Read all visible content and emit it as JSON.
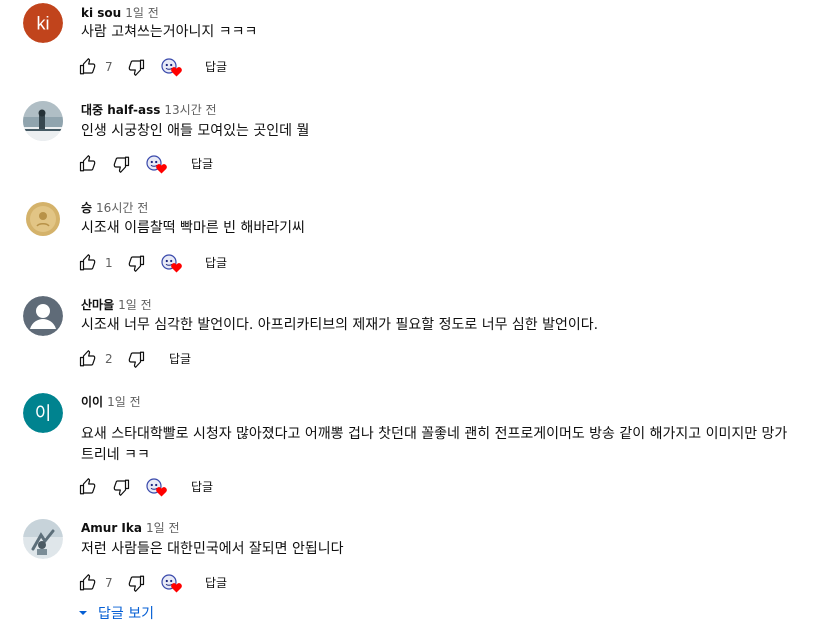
{
  "comments": [
    {
      "author": "ki sou",
      "time": "1일 전",
      "text": "사람 고쳐쓰는거아니지 ㅋㅋㅋ",
      "likes": "7",
      "reply_label": "답글",
      "avatar_text": "ki",
      "avatar_color": "#c1441c"
    },
    {
      "author": "대중 half-ass",
      "time": "13시간 전",
      "text": "인생 시궁창인 애들 모여있는 곳인데 뭘",
      "likes": "",
      "reply_label": "답글"
    },
    {
      "author": "승",
      "time": "16시간 전",
      "text": "시조새 이름찰떡 빡마른 빈 해바라기씨",
      "likes": "1",
      "reply_label": "답글"
    },
    {
      "author": "산마을",
      "time": "1일 전",
      "text": "시조새 너무 심각한 발언이다. 아프리카티브의 제재가 필요할 정도로 너무 심한 발언이다.",
      "likes": "2",
      "reply_label": "답글"
    },
    {
      "author": "이이",
      "time": "1일 전",
      "text_line1": "요새 스타대학빨로 시청자 많아졌다고 어깨뽕 겁나 찻던대 꼴좋네 괜히 전프로게이머도 방송 같이 해가지고 이미지만 망가",
      "text_line2": "트리네 ㅋㅋ",
      "likes": "",
      "reply_label": "답글",
      "avatar_text": "이",
      "avatar_color": "#00838f"
    },
    {
      "author": "Amur Ika",
      "time": "1일 전",
      "text": "저런 사람들은 대한민국에서 잘되면 안됩니다",
      "likes": "7",
      "reply_label": "답글"
    }
  ],
  "replies_toggle": {
    "label": "답글 보기",
    "icon": "caret-down-icon",
    "color": "#065fd4"
  },
  "icons": {
    "like": "thumb-up-icon",
    "dislike": "thumb-down-icon",
    "creator_heart": "creator-heart-icon"
  },
  "colors": {
    "heart": "#ff0000",
    "link": "#065fd4",
    "secondary_text": "#606060"
  }
}
